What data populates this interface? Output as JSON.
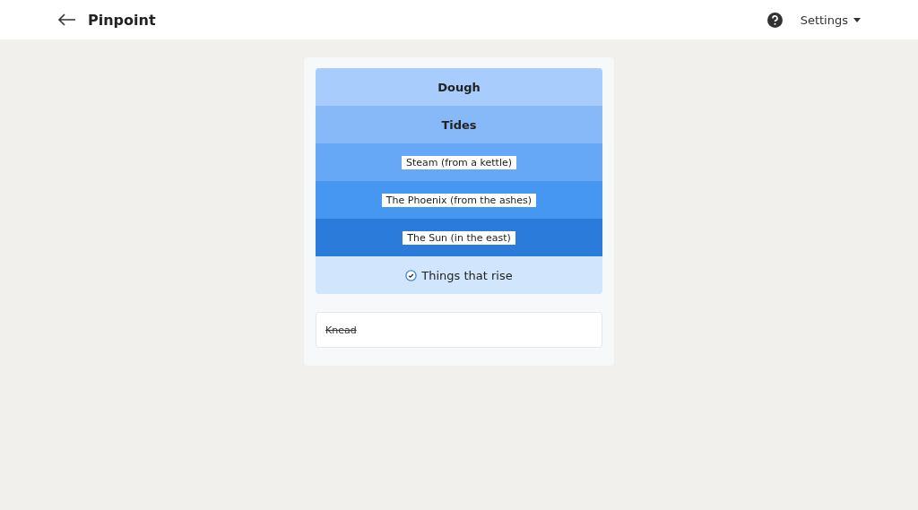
{
  "header": {
    "title": "Pinpoint",
    "settings": "Settings"
  },
  "clues": [
    {
      "text": "Dough",
      "kind": "plain",
      "color": "#a8cdfc"
    },
    {
      "text": "Tides",
      "kind": "plain",
      "color": "#87b9f8"
    },
    {
      "text": "Steam (from a kettle)",
      "kind": "boxed",
      "color": "#66a8f6"
    },
    {
      "text": "The Phoenix (from the ashes)",
      "kind": "boxed",
      "color": "#4597f2"
    },
    {
      "text": "The Sun (in the east)",
      "kind": "boxed",
      "color": "#2b7bdb"
    }
  ],
  "answer": {
    "text": "Things that rise",
    "solved": true
  },
  "guesses": [
    {
      "text": "Knead",
      "wrong": true
    }
  ]
}
